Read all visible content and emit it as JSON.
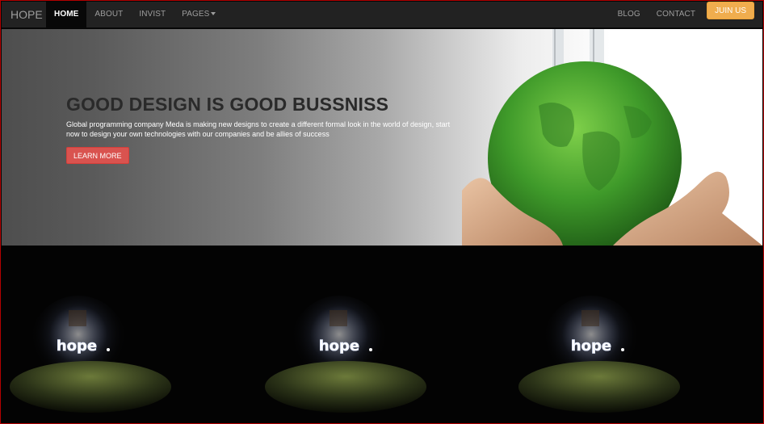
{
  "nav": {
    "brand": "HOPE",
    "left_items": [
      {
        "label": "HOME",
        "active": true
      },
      {
        "label": "ABOUT",
        "active": false
      },
      {
        "label": "INVIST",
        "active": false
      },
      {
        "label": "PAGES",
        "active": false,
        "has_dropdown": true
      }
    ],
    "right_items": [
      {
        "label": "BLOG"
      },
      {
        "label": "CONTACT"
      }
    ],
    "join_label": "JUIN US"
  },
  "hero": {
    "title": "GOOD DESIGN IS GOOD BUSSNISS",
    "text": "Global programming company Meda is making new designs to create a different formal look in the world of design, start now to design your own technologies with our companies and be allies of success",
    "button_label": "LEARN MORE",
    "image_icon": "earth-in-hands-image"
  },
  "panels": [
    {
      "image_icon": "hope-neon-sign-image"
    },
    {
      "image_icon": "hope-neon-sign-image"
    },
    {
      "image_icon": "hope-neon-sign-image"
    }
  ],
  "colors": {
    "navbar_bg": "#222222",
    "nav_text": "#9d9d9d",
    "join_button": "#f0ad4e",
    "learn_button": "#d9534f",
    "frame_border": "#b30000"
  }
}
